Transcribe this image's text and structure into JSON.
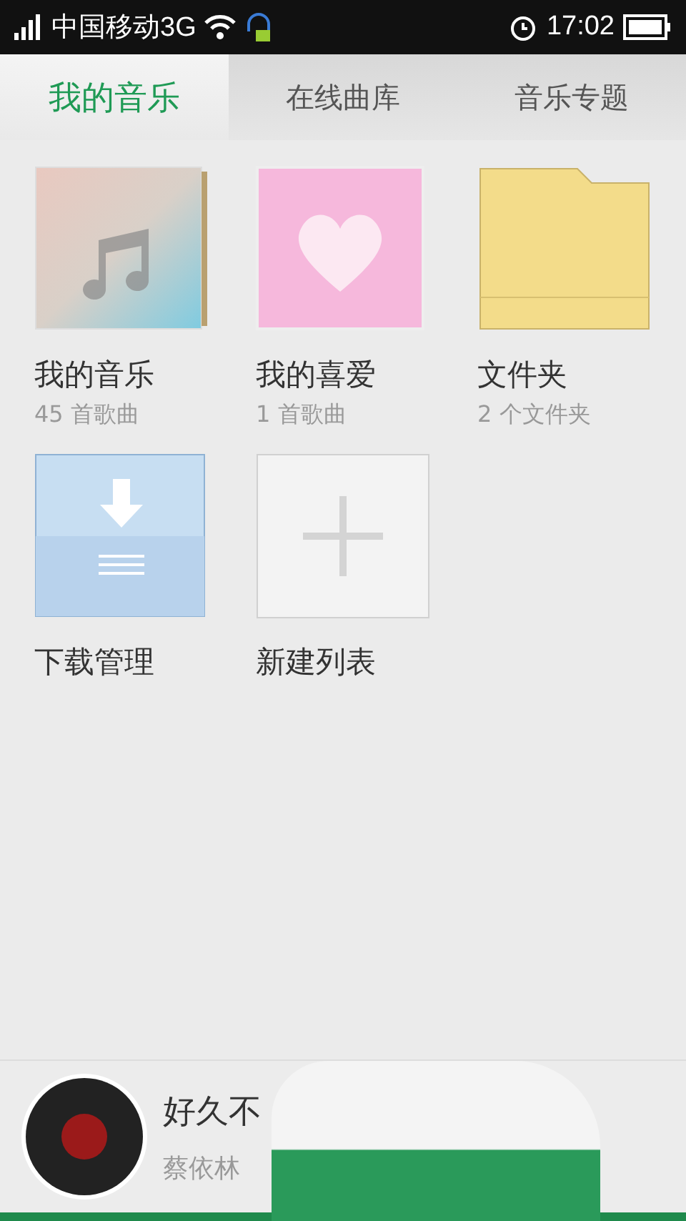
{
  "status_bar": {
    "carrier": "中国移动3G",
    "time": "17:02"
  },
  "tabs": [
    {
      "label": "我的音乐",
      "selected": true
    },
    {
      "label": "在线曲库",
      "selected": false
    },
    {
      "label": "音乐专题",
      "selected": false
    }
  ],
  "tiles": [
    {
      "kind": "music",
      "title": "我的音乐",
      "subtitle": "45 首歌曲"
    },
    {
      "kind": "favorite",
      "title": "我的喜爱",
      "subtitle": "1 首歌曲"
    },
    {
      "kind": "folder",
      "title": "文件夹",
      "subtitle": "2 个文件夹"
    },
    {
      "kind": "download",
      "title": "下载管理"
    },
    {
      "kind": "new",
      "title": "新建列表"
    }
  ],
  "player": {
    "song": "好久不",
    "artist": "蔡依林"
  }
}
